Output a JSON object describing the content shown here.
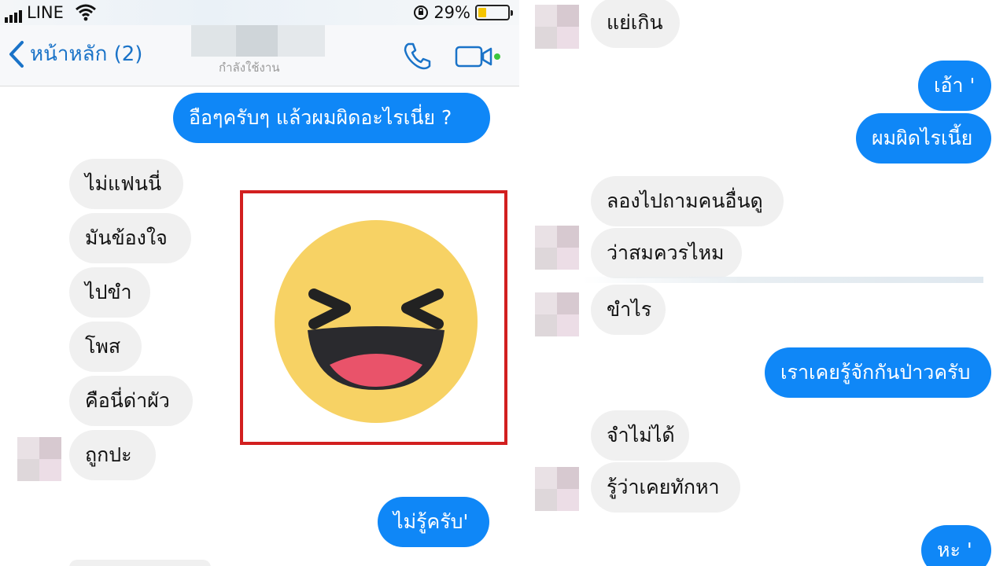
{
  "status_bar": {
    "carrier": "LINE",
    "battery_text": "29%",
    "battery_level": 0.29
  },
  "nav": {
    "back_label": "หน้าหลัก (2)",
    "active_status": "กำลังใช้งาน"
  },
  "colors": {
    "accent": "#0f87f7",
    "incoming_bubble": "#f0f0f0",
    "highlight_box": "#d21f1f",
    "emoji_face": "#f7d264"
  },
  "left_messages": [
    {
      "text": "อือๆครับๆ แล้วผมผิดอะไรเนี่ย ?",
      "direction": "sent"
    },
    {
      "text": "ไม่แฟนนี่",
      "direction": "received"
    },
    {
      "text": "มันข้องใจ",
      "direction": "received"
    },
    {
      "text": "ไปขำ",
      "direction": "received"
    },
    {
      "text": "โพส",
      "direction": "received"
    },
    {
      "text": "คือนี่ด่าผัว",
      "direction": "received"
    },
    {
      "text": "ถูกปะ",
      "direction": "received"
    },
    {
      "text": "ไม่รู้ครับ'",
      "direction": "sent"
    }
  ],
  "reaction": {
    "icon": "laughing-emoji-icon"
  },
  "right_messages": [
    {
      "text": "แย่เกิน",
      "direction": "received"
    },
    {
      "text": "เอ้า '",
      "direction": "sent"
    },
    {
      "text": "ผมผิดไรเนี้ย",
      "direction": "sent"
    },
    {
      "text": "ลองไปถามคนอื่นดู",
      "direction": "received"
    },
    {
      "text": "ว่าสมควรไหม",
      "direction": "received"
    },
    {
      "text": "ขำไร",
      "direction": "received"
    },
    {
      "text": "เราเคยรู้จักกันป่าวครับ",
      "direction": "sent"
    },
    {
      "text": "จำไม่ได้",
      "direction": "received"
    },
    {
      "text": "รู้ว่าเคยทักหา",
      "direction": "received"
    },
    {
      "text": "หะ '",
      "direction": "sent"
    }
  ]
}
